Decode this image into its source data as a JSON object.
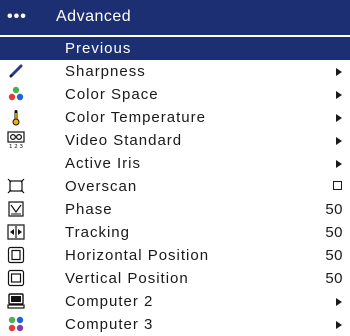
{
  "header": {
    "dots": "•••",
    "title": "Advanced"
  },
  "items": [
    {
      "label": "Previous",
      "control": "none",
      "icon": "none"
    },
    {
      "label": "Sharpness",
      "control": "arrow",
      "icon": "pen-icon"
    },
    {
      "label": "Color Space",
      "control": "arrow",
      "icon": "color-space-icon"
    },
    {
      "label": "Color Temperature",
      "control": "arrow",
      "icon": "thermometer-icon"
    },
    {
      "label": "Video Standard",
      "control": "arrow",
      "icon": "video-standard-icon"
    },
    {
      "label": "Active Iris",
      "control": "arrow",
      "icon": "none"
    },
    {
      "label": "Overscan",
      "control": "checkbox",
      "icon": "overscan-icon"
    },
    {
      "label": "Phase",
      "control": "value",
      "value": "50",
      "icon": "phase-icon"
    },
    {
      "label": "Tracking",
      "control": "value",
      "value": "50",
      "icon": "tracking-icon"
    },
    {
      "label": "Horizontal Position",
      "control": "value",
      "value": "50",
      "icon": "horizontal-position-icon"
    },
    {
      "label": "Vertical Position",
      "control": "value",
      "value": "50",
      "icon": "vertical-position-icon"
    },
    {
      "label": "Computer 2",
      "control": "arrow",
      "icon": "computer-icon"
    },
    {
      "label": "Computer 3",
      "control": "arrow",
      "icon": "computer-3-icon"
    }
  ],
  "colors": {
    "header_bg": "#1c2f73",
    "selected_bg": "#1c2f73",
    "text": "#1a1a1a",
    "selected_text": "#ffffff"
  }
}
